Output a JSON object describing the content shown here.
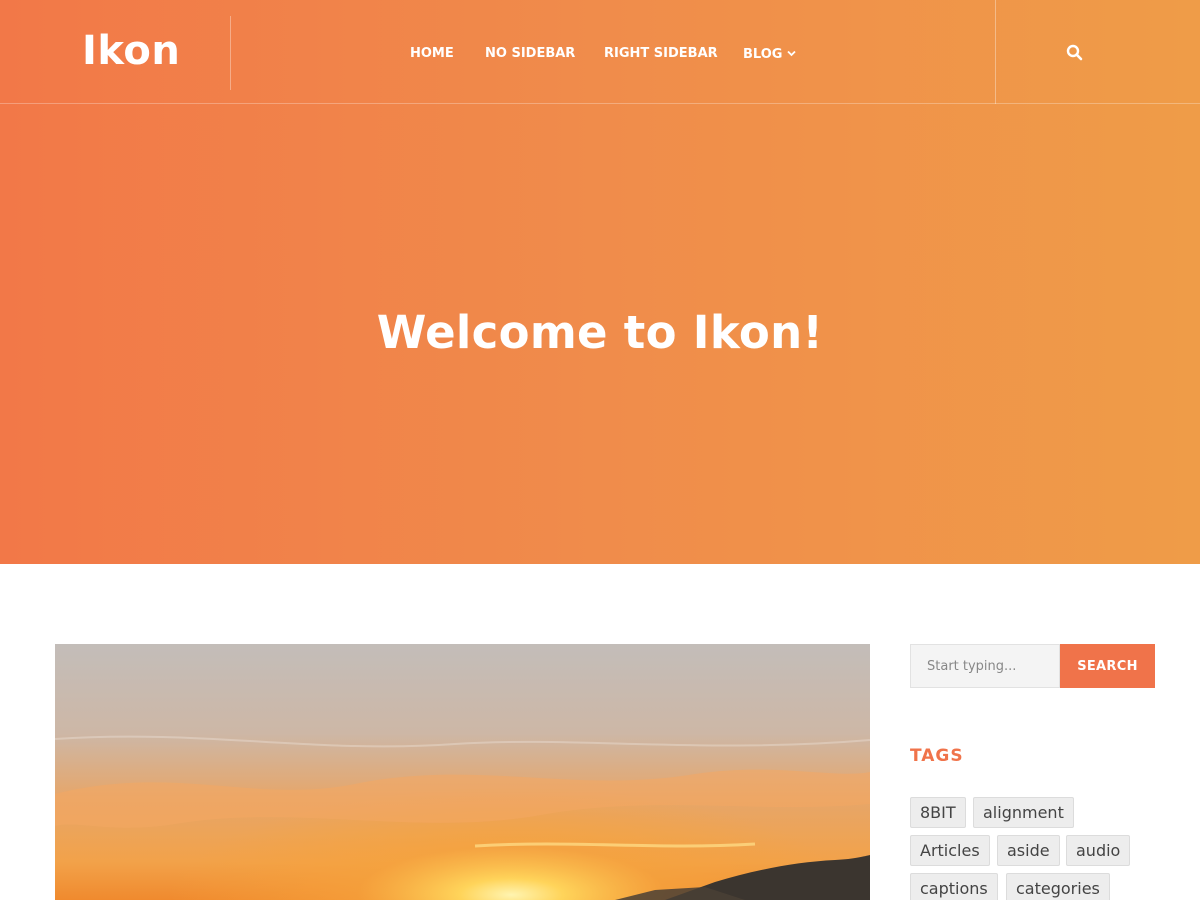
{
  "site": {
    "logo": "Ikon"
  },
  "nav": {
    "items": [
      {
        "label": "HOME"
      },
      {
        "label": "NO SIDEBAR"
      },
      {
        "label": "RIGHT SIDEBAR"
      },
      {
        "label": "BLOG",
        "has_dropdown": true
      }
    ],
    "search_icon": "search-icon"
  },
  "hero": {
    "title": "Welcome to Ikon!"
  },
  "sidebar": {
    "search": {
      "placeholder": "Start typing...",
      "button": "SEARCH"
    },
    "tags": {
      "heading": "TAGS",
      "items": [
        "8BIT",
        "alignment",
        "Articles",
        "aside",
        "audio",
        "captions",
        "categories"
      ]
    }
  },
  "colors": {
    "accent": "#f0734a",
    "hero_gradient_start": "#f27848",
    "hero_gradient_end": "#ef9c48"
  },
  "featured_image": {
    "subject": "sunset over dunes"
  }
}
